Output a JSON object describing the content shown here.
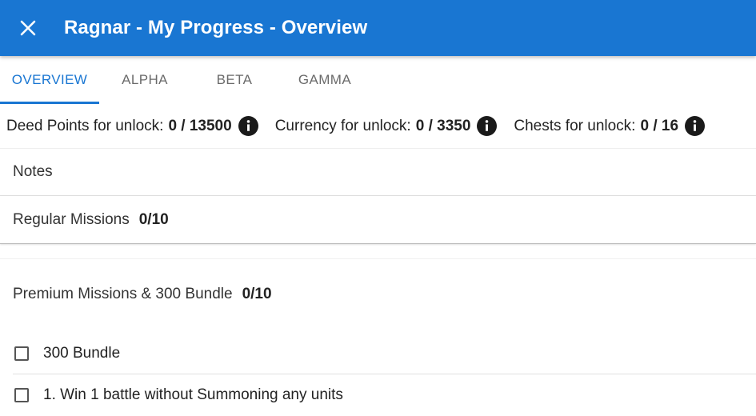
{
  "appbar": {
    "title": "Ragnar - My Progress - Overview",
    "close_icon": "close-icon",
    "color": "#1976d2"
  },
  "tabs": [
    {
      "label": "OVERVIEW",
      "active": true
    },
    {
      "label": "ALPHA",
      "active": false
    },
    {
      "label": "BETA",
      "active": false
    },
    {
      "label": "GAMMA",
      "active": false
    }
  ],
  "stats": {
    "deed_points": {
      "label": "Deed Points for unlock:",
      "value": "0 / 13500",
      "icon": "info-icon"
    },
    "currency": {
      "label": "Currency for unlock:",
      "value": "0 / 3350",
      "icon": "info-icon"
    },
    "chests": {
      "label": "Chests for unlock:",
      "value": "0 / 16",
      "icon": "info-icon"
    }
  },
  "sections": {
    "notes": {
      "label": "Notes"
    },
    "regular": {
      "label": "Regular Missions",
      "count": "0/10"
    },
    "premium": {
      "label": "Premium Missions & 300 Bundle",
      "count": "0/10"
    }
  },
  "tasks": [
    {
      "label": "300 Bundle",
      "checked": false
    },
    {
      "label": "1. Win 1 battle without Summoning any units",
      "checked": false
    }
  ]
}
